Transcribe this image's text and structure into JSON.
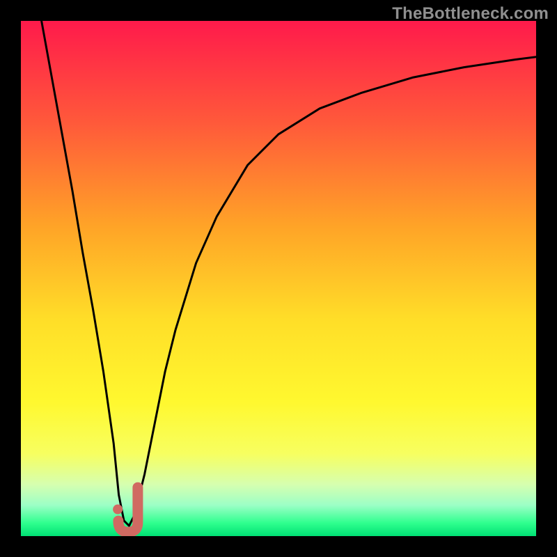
{
  "watermark": "TheBottleneck.com",
  "colors": {
    "background": "#000000",
    "curve": "#000000",
    "marker": "#d06a62",
    "gradient_stops": [
      {
        "offset": 0.0,
        "color": "#ff1a4b"
      },
      {
        "offset": 0.2,
        "color": "#ff5a3a"
      },
      {
        "offset": 0.4,
        "color": "#ffa427"
      },
      {
        "offset": 0.58,
        "color": "#ffde28"
      },
      {
        "offset": 0.74,
        "color": "#fff82f"
      },
      {
        "offset": 0.84,
        "color": "#f7ff60"
      },
      {
        "offset": 0.9,
        "color": "#d6ffb0"
      },
      {
        "offset": 0.94,
        "color": "#9cffc6"
      },
      {
        "offset": 0.975,
        "color": "#2eff8e"
      },
      {
        "offset": 1.0,
        "color": "#00e074"
      }
    ]
  },
  "chart_data": {
    "type": "line",
    "title": "",
    "xlabel": "",
    "ylabel": "",
    "xlim": [
      0,
      100
    ],
    "ylim": [
      0,
      100
    ],
    "series": [
      {
        "name": "bottleneck-curve",
        "x": [
          4,
          6,
          8,
          10,
          12,
          14,
          16,
          18,
          19,
          20,
          21,
          22,
          24,
          26,
          28,
          30,
          34,
          38,
          44,
          50,
          58,
          66,
          76,
          86,
          96,
          100
        ],
        "y": [
          100,
          89,
          78,
          67,
          55,
          44,
          32,
          18,
          8,
          3,
          2,
          4,
          12,
          22,
          32,
          40,
          53,
          62,
          72,
          78,
          83,
          86,
          89,
          91,
          92.5,
          93
        ]
      }
    ],
    "marker": {
      "name": "optimal-point",
      "shape": "J",
      "x": 20.8,
      "y": 3.5,
      "dot": {
        "x": 18.8,
        "y": 5.2
      }
    }
  }
}
